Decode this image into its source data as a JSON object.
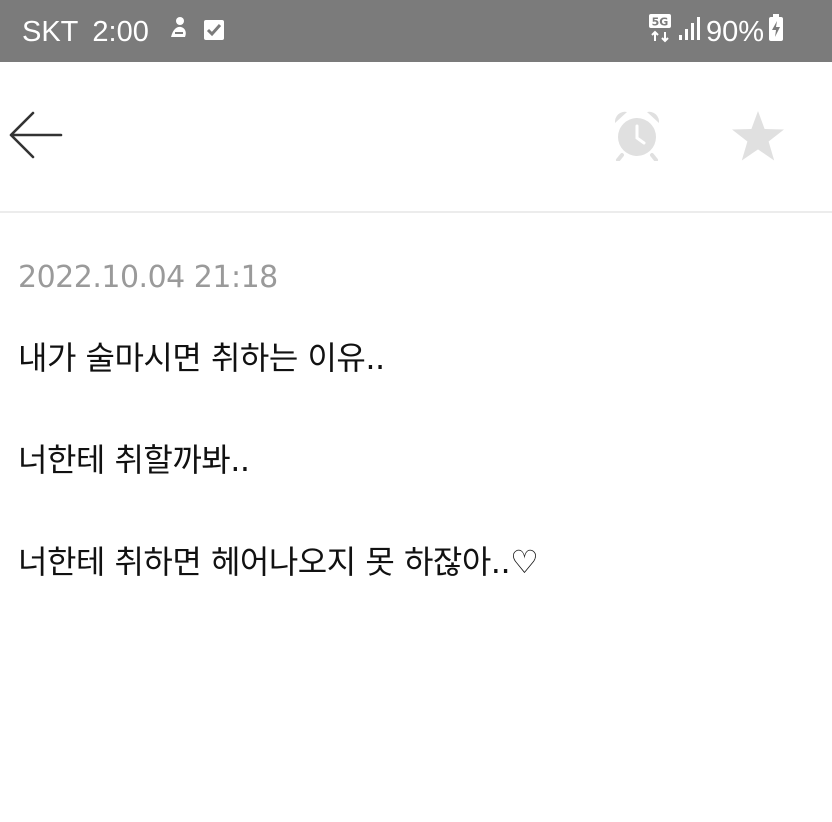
{
  "status_bar": {
    "carrier": "SKT",
    "time": "2:00",
    "network": "5G",
    "battery": "90%",
    "background_color": "#7b7b7b",
    "icons": [
      "notification-app-icon",
      "checkbox-icon",
      "network-5g-icon",
      "signal-icon",
      "battery-charging-icon"
    ]
  },
  "header": {
    "icons": [
      "back-arrow-icon",
      "alarm-clock-icon",
      "star-icon"
    ],
    "icon_color": "#e0e0e0"
  },
  "memo": {
    "date": "2022.10.04 21:18",
    "lines": [
      "내가 술마시면 취하는 이유..",
      "너한테 취할까봐..",
      "너한테 취하면 헤어나오지 못 하잖아..♡"
    ]
  }
}
